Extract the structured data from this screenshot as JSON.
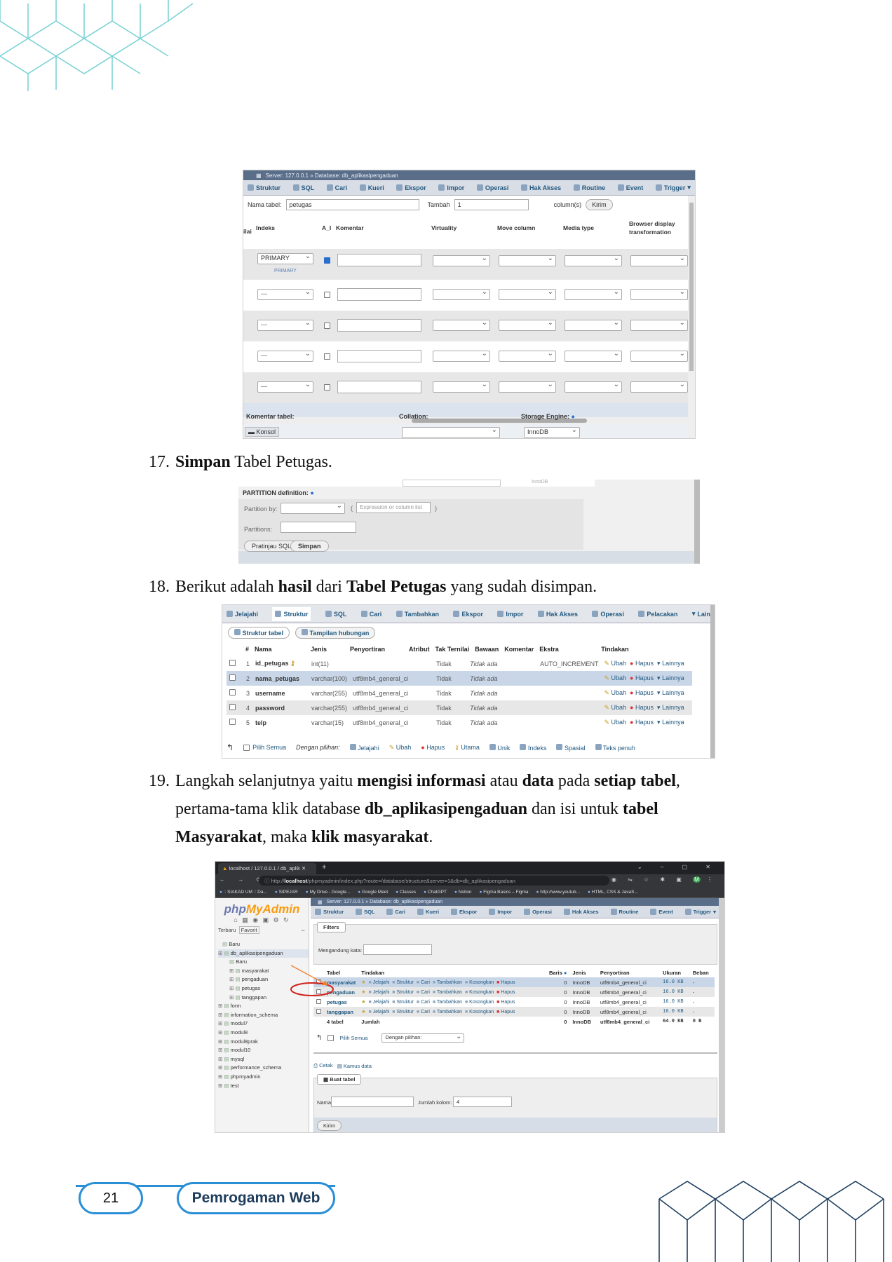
{
  "steps": {
    "s17": {
      "num": "17.",
      "bold": "Simpan",
      "rest": " Tabel Petugas."
    },
    "s18": {
      "num": "18.",
      "p1": "Berikut adalah ",
      "b1": "hasil",
      "p2": " dari ",
      "b2": "Tabel Petugas",
      "p3": " yang sudah disimpan."
    },
    "s19": {
      "num": "19.",
      "p1": "Langkah selanjutnya yaitu ",
      "b1": "mengisi informasi",
      "p2": " atau ",
      "b2": "data",
      "p3": " pada ",
      "b3": "setiap tabel",
      "p4": ",",
      "l2a": "pertama-tama klik database ",
      "l2b": "db_aplikasipengaduan",
      "l2c": " dan isi untuk ",
      "l2d": "tabel",
      "l3a": "Masyarakat",
      "l3b": ", maka ",
      "l3c": "klik masyarakat",
      "l3d": "."
    }
  },
  "shot1": {
    "title": "Server: 127.0.0.1 » Database: db_aplikasipengaduan",
    "tabs": [
      "Struktur",
      "SQL",
      "Cari",
      "Kueri",
      "Ekspor",
      "Impor",
      "Operasi",
      "Hak Akses",
      "Routine",
      "Event",
      "Trigger"
    ],
    "nama_tabel_label": "Nama tabel:",
    "nama_tabel_value": "petugas",
    "tambah_label": "Tambah",
    "tambah_value": "1",
    "columns_label": "column(s)",
    "kirim": "Kirim",
    "headers": {
      "nilai": "ilai",
      "indeks": "Indeks",
      "ai": "A_I",
      "komentar": "Komentar",
      "virtuality": "Virtuality",
      "move": "Move column",
      "media": "Media type",
      "browser": "Browser display transformation"
    },
    "primary": "PRIMARY",
    "primary_small": "PRIMARY",
    "dash": "---",
    "komentar_tabel": "Komentar tabel:",
    "collation": "Collation:",
    "storage": "Storage Engine:",
    "engine": "InnoDB",
    "konsol": "Konsol"
  },
  "shot2": {
    "partition_title": "PARTITION definition:",
    "partition_by": "Partition by:",
    "expr_placeholder": "Expression or column list",
    "partitions": "Partitions:",
    "pratinjau": "Pratinjau SQL",
    "simpan": "Simpan",
    "engine": "InnoDB"
  },
  "shot3": {
    "tabs": [
      "Jelajahi",
      "Struktur",
      "SQL",
      "Cari",
      "Tambahkan",
      "Ekspor",
      "Impor",
      "Hak Akses",
      "Operasi",
      "Pelacakan",
      "Lain"
    ],
    "subtabs": [
      "Struktur tabel",
      "Tampilan hubungan"
    ],
    "headers": [
      "#",
      "Nama",
      "Jenis",
      "Penyortiran",
      "Atribut",
      "Tak Ternilai",
      "Bawaan",
      "Komentar",
      "Ekstra",
      "Tindakan"
    ],
    "rows": [
      {
        "no": "1",
        "name": "id_petugas",
        "type": "int(11)",
        "coll": "",
        "null": "Tidak",
        "def": "Tidak ada",
        "extra": "AUTO_INCREMENT"
      },
      {
        "no": "2",
        "name": "nama_petugas",
        "type": "varchar(100)",
        "coll": "utf8mb4_general_ci",
        "null": "Tidak",
        "def": "Tidak ada",
        "extra": ""
      },
      {
        "no": "3",
        "name": "username",
        "type": "varchar(255)",
        "coll": "utf8mb4_general_ci",
        "null": "Tidak",
        "def": "Tidak ada",
        "extra": ""
      },
      {
        "no": "4",
        "name": "password",
        "type": "varchar(255)",
        "coll": "utf8mb4_general_ci",
        "null": "Tidak",
        "def": "Tidak ada",
        "extra": ""
      },
      {
        "no": "5",
        "name": "telp",
        "type": "varchar(15)",
        "coll": "utf8mb4_general_ci",
        "null": "Tidak",
        "def": "Tidak ada",
        "extra": ""
      }
    ],
    "actions": [
      "Ubah",
      "Hapus",
      "Lainnya"
    ],
    "footer": [
      "Pilih Semua",
      "Dengan pilihan:",
      "Jelajahi",
      "Ubah",
      "Hapus",
      "Utama",
      "Unik",
      "Indeks",
      "Spasial",
      "Teks penuh"
    ]
  },
  "shot4": {
    "tab_title": "localhost / 127.0.0.1 / db_aplik",
    "url_pre": "http://",
    "url_host": "localhost",
    "url_rest": "/phpmyadmin/index.php?route=/database/structure&server=1&db=db_aplikasipengaduan",
    "bookmarks": [
      ":: SIAKAD UM :: Da...",
      "SIPEJAR",
      "My Drive - Google...",
      "Google Meet",
      "Classes",
      "ChatGPT",
      "Notion",
      "Figma Basics – Figma",
      "http://www.youtub...",
      "HTML, CSS & JavaS..."
    ],
    "logo_a": "php",
    "logo_b": "MyAdmin",
    "recent": "Terbaru",
    "fav": "Favorit",
    "tree": [
      "Baru",
      "db_aplikasipengaduan",
      "Baru",
      "masyarakat",
      "pengaduan",
      "petugas",
      "tanggapan",
      "form",
      "information_schema",
      "modul7",
      "modul8",
      "modul8prak",
      "modul10",
      "mysql",
      "performance_schema",
      "phpmyadmin",
      "test"
    ],
    "title": "Server: 127.0.0.1 » Database: db_aplikasipengaduan",
    "tabs": [
      "Struktur",
      "SQL",
      "Cari",
      "Kueri",
      "Ekspor",
      "Impor",
      "Operasi",
      "Hak Akses",
      "Routine",
      "Event",
      "Trigger"
    ],
    "filters": "Filters",
    "contains": "Mengandung kata:",
    "headers": [
      "Tabel",
      "Tindakan",
      "Baris",
      "Jenis",
      "Penyortiran",
      "Ukuran",
      "Beban"
    ],
    "row_actions": [
      "Jelajahi",
      "Struktur",
      "Cari",
      "Tambahkan",
      "Kosongkan",
      "Hapus"
    ],
    "tables": [
      {
        "name": "masyarakat",
        "rows": "0",
        "engine": "InnoDB",
        "coll": "utf8mb4_general_ci",
        "size": "16.0 KB",
        "ovh": "-"
      },
      {
        "name": "pengaduan",
        "rows": "0",
        "engine": "InnoDB",
        "coll": "utf8mb4_general_ci",
        "size": "16.0 KB",
        "ovh": "-"
      },
      {
        "name": "petugas",
        "rows": "0",
        "engine": "InnoDB",
        "coll": "utf8mb4_general_ci",
        "size": "16.0 KB",
        "ovh": "-"
      },
      {
        "name": "tanggapan",
        "rows": "0",
        "engine": "InnoDB",
        "coll": "utf8mb4_general_ci",
        "size": "16.0 KB",
        "ovh": "-"
      }
    ],
    "total_label": "4 tabel",
    "total_sum": "Jumlah",
    "total_rows": "0",
    "total_engine": "InnoDB",
    "total_coll": "utf8mb4_general_ci",
    "total_size": "64.0 KB",
    "total_ovh": "0 B",
    "check_all": "Pilih Semua",
    "with_sel": "Dengan pilihan:",
    "print": "Cetak",
    "dict": "Kamus data",
    "create": "Buat tabel",
    "name_label": "Nama:",
    "cols_label": "Jumlah kolom:",
    "cols_value": "4",
    "kirim": "Kirim"
  },
  "footer": {
    "page": "21",
    "label": "Pemrogaman Web"
  },
  "colors": {
    "accent": "#2b8fd6",
    "hex": "#7fd3d6",
    "pma_nav": "#235a81"
  }
}
